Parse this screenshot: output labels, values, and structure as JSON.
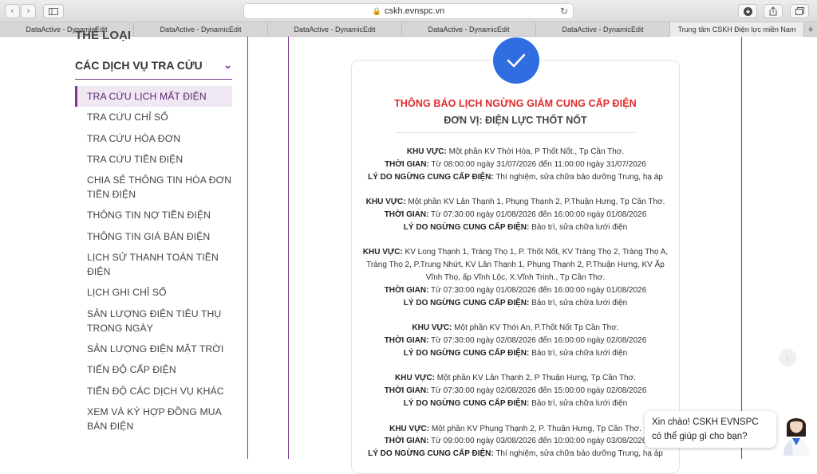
{
  "browser": {
    "url": "cskh.evnspc.vn",
    "tabs": [
      {
        "label": "DataActive - DynamicEdit",
        "active": false
      },
      {
        "label": "DataActive - DynamicEdit",
        "active": false
      },
      {
        "label": "DataActive - DynamicEdit",
        "active": false
      },
      {
        "label": "DataActive - DynamicEdit",
        "active": false
      },
      {
        "label": "DataActive - DynamicEdit",
        "active": false
      },
      {
        "label": "Trung tâm CSKH Điện lực miền Nam",
        "active": true
      }
    ]
  },
  "sidebar": {
    "partial_heading": "THỂ LOẠI",
    "section_title": "CÁC DỊCH VỤ TRA CỨU",
    "items": [
      {
        "label": "TRA CỨU LỊCH MẤT ĐIỆN",
        "active": true
      },
      {
        "label": "TRA CỨU CHỈ SỐ"
      },
      {
        "label": "TRA CỨU HÓA ĐƠN"
      },
      {
        "label": "TRA CỨU TIỀN ĐIỆN"
      },
      {
        "label": "CHIA SẺ THÔNG TIN HÓA ĐƠN TIỀN ĐIỆN"
      },
      {
        "label": "THÔNG TIN NỢ TIỀN ĐIỆN"
      },
      {
        "label": "THÔNG TIN GIÁ BÁN ĐIỆN"
      },
      {
        "label": "LỊCH SỬ THANH TOÁN TIỀN ĐIỆN"
      },
      {
        "label": "LỊCH GHI CHỈ SỐ"
      },
      {
        "label": "SẢN LƯỢNG ĐIỆN TIÊU THỤ TRONG NGÀY"
      },
      {
        "label": "SẢN LƯỢNG ĐIỆN MẶT TRỜI"
      },
      {
        "label": "TIẾN ĐỘ CẤP ĐIỆN"
      },
      {
        "label": "TIẾN ĐỘ CÁC DỊCH VỤ KHÁC"
      },
      {
        "label": "XEM VÀ KÝ HỢP ĐỒNG MUA BÁN ĐIỆN"
      }
    ]
  },
  "card": {
    "title": "THÔNG BÁO LỊCH NGỪNG GIẢM CUNG CẤP ĐIỆN",
    "subtitle": "ĐƠN VỊ: ĐIỆN LỰC THỐT NỐT",
    "labels": {
      "area": "KHU VỰC:",
      "time": "THỜI GIAN:",
      "reason": "LÝ DO NGỪNG CUNG CẤP ĐIỆN:"
    },
    "notices": [
      {
        "area": "Một phần KV Thới Hòa, P Thốt Nốt., Tp Cần Thơ.",
        "time": "Từ 08:00:00 ngày 31/07/2026 đến 11:00:00 ngày 31/07/2026",
        "reason": "Thí nghiệm, sửa chữa bảo dưỡng Trung, hạ áp"
      },
      {
        "area": "Một phần KV Lân Thạnh 1, Phụng Thạnh 2, P.Thuận Hưng, Tp Cần Thơ.",
        "time": "Từ 07:30:00 ngày 01/08/2026 đến 16:00:00 ngày 01/08/2026",
        "reason": "Bảo trì, sửa chữa lưới điện"
      },
      {
        "area": "KV Long Thạnh 1, Tràng Thọ 1, P. Thốt Nốt, KV Tràng Thọ 2, Tràng Thọ A, Tràng Thọ 2, P.Trung Nhứt, KV Lân Thạnh 1, Phụng Thạnh 2, P.Thuận Hưng, KV Ấp Vĩnh Thọ, ấp Vĩnh Lộc, X.Vĩnh Trinh., Tp Cần Thơ.",
        "time": "Từ 07:30:00 ngày 01/08/2026 đến 16:00:00 ngày 01/08/2026",
        "reason": "Bảo trì, sửa chữa lưới điện"
      },
      {
        "area": "Một phần KV Thới An, P.Thốt Nốt Tp Cần Thơ.",
        "time": "Từ 07:30:00 ngày 02/08/2026 đến 16:00:00 ngày 02/08/2026",
        "reason": "Bảo trì, sửa chữa lưới điện"
      },
      {
        "area": "Một phần KV Lân Thạnh 2, P Thuận Hưng, Tp Cần Thơ.",
        "time": "Từ 07:30:00 ngày 02/08/2026 đến 15:00:00 ngày 02/08/2026",
        "reason": "Bảo trì, sửa chữa lưới điện"
      },
      {
        "area": "Một phần KV Phụng Thạnh 2, P. Thuận Hưng, Tp Cần Thơ.",
        "time": "Từ 09:00:00 ngày 03/08/2026 đến 10:00:00 ngày 03/08/2026",
        "reason": "Thí nghiệm, sửa chữa bảo dưỡng Trung, hạ áp"
      }
    ]
  },
  "chat": {
    "line1": "Xin chào! CSKH EVNSPC",
    "line2": "có thể giúp gì cho bạn?"
  },
  "colors": {
    "accent": "#7d3b8f",
    "title_red": "#e12a2a",
    "check_blue": "#2f6de0"
  }
}
